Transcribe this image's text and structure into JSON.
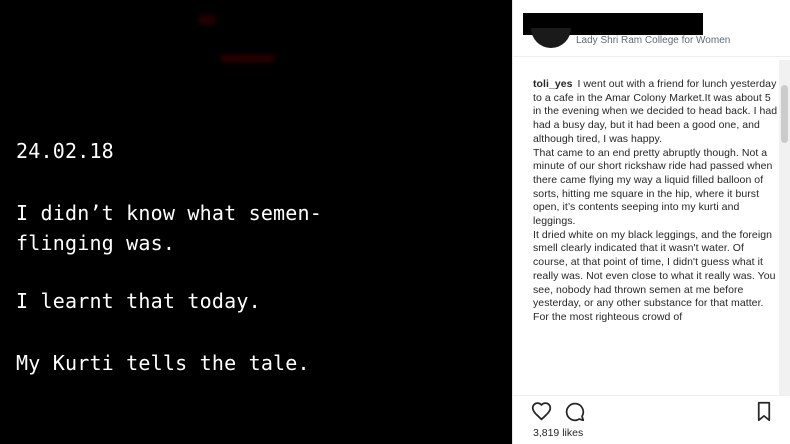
{
  "post_image": {
    "date": "24.02.18",
    "line1": "I didn’t know what semen-\nflinging was.",
    "line2": "I learnt that today.",
    "line3": "My Kurti tells the tale."
  },
  "post_header": {
    "location": "Lady Shri Ram College for Women"
  },
  "caption": {
    "username": "toli_yes",
    "para1": "I went out with a friend for lunch yesterday to a cafe in the Amar Colony Market.It was about 5 in the evening when we decided to head back. I had had a busy day, but it had been a good one, and although tired, I was happy.",
    "para2": "That came to an end pretty abruptly though. Not a minute of our short rickshaw ride had passed when there came flying my way a liquid filled balloon of sorts, hitting me square in the hip, where it burst open, it’s contents seeping into my kurti and leggings.",
    "para3": "It dried white on my black leggings, and the foreign smell clearly indicated that it wasn't water. Of course, at that point of time, I didn't guess what it really was. Not even close to what it really was. You see, nobody had thrown semen at me before yesterday, or any other substance for that matter. For the most righteous crowd of"
  },
  "engagement": {
    "likes": "3,819 likes"
  },
  "icons": {
    "heart": "heart-icon",
    "comment": "comment-icon",
    "bookmark": "bookmark-icon"
  },
  "colors": {
    "image_background": "#000000",
    "image_text": "#ffffff",
    "caption_text": "#262626",
    "location_text": "#5f6b78",
    "border": "#efefef"
  }
}
